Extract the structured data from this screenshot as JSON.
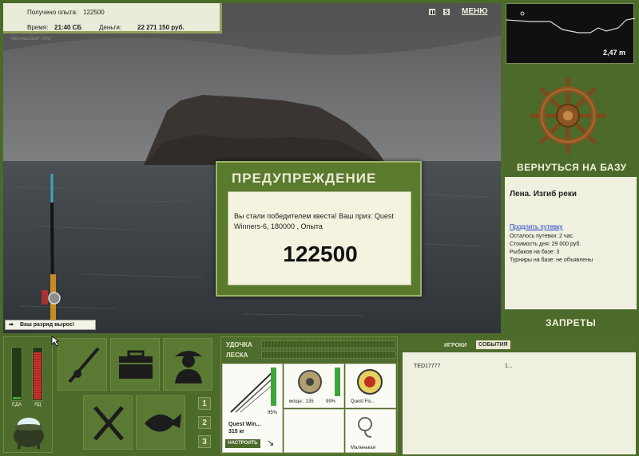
{
  "top_info": {
    "exp_label": "Получено опыта:",
    "exp_value": "122500",
    "time_label": "Время:",
    "time_value": "21:40 СБ",
    "money_label": "Деньги:",
    "money_value": "22 271 150 руб.",
    "watermark": "INSTALLSOFT.RU"
  },
  "toolbar": {
    "pause_icon": "pause-icon",
    "settings_icon": "s-icon",
    "menu_label": "МЕНЮ"
  },
  "depth": {
    "value": "2,47 m"
  },
  "base": {
    "return_label": "ВЕРНУТЬСЯ НА БАЗУ",
    "name": "Лена. Изгиб реки",
    "extend_link": "Продлить путевку",
    "lines": [
      "Осталось путевки: 2 час.",
      "Стоимость дня: 29 000 руб.",
      "Рыбаков на базе: 3",
      "Турниры на базе: не объявлены"
    ],
    "bans_label": "ЗАПРЕТЫ"
  },
  "dialog": {
    "title": "ПРЕДУПРЕЖДЕНИЕ",
    "message": "Вы стали победителем квеста! Ваш приз: Quest Winners-6, 180000 , Опыта",
    "amount": "122500"
  },
  "rank_notice": "Ваш разряд вырос!",
  "meters": {
    "food_label": "ЕДА",
    "poison_label": "ЯД",
    "food_level": 0.05,
    "poison_level": 0.92
  },
  "tackle": {
    "rod_label": "УДОЧКА",
    "line_label": "ЛЕСКА",
    "rod_name": "Quest Win...",
    "rod_weight": "315 кг",
    "rod_condition": "95%",
    "reel_name": "мощн.: 135",
    "reel_condition": "99%",
    "line_name": "Quest Fis...",
    "lure_name": "Маленькая",
    "setup_button": "НАСТРОИТЬ"
  },
  "players": {
    "tab_players": "ИГРОКИ",
    "tab_events": "СОБЫТИЯ",
    "rows": [
      {
        "name": "TED17777",
        "value": "1..."
      }
    ]
  },
  "slots": [
    "1",
    "2",
    "3"
  ],
  "colors": {
    "panel": "#4c6a2a",
    "accent": "#f2f2de",
    "poison": "#c8322a",
    "food": "#3ea53a"
  }
}
